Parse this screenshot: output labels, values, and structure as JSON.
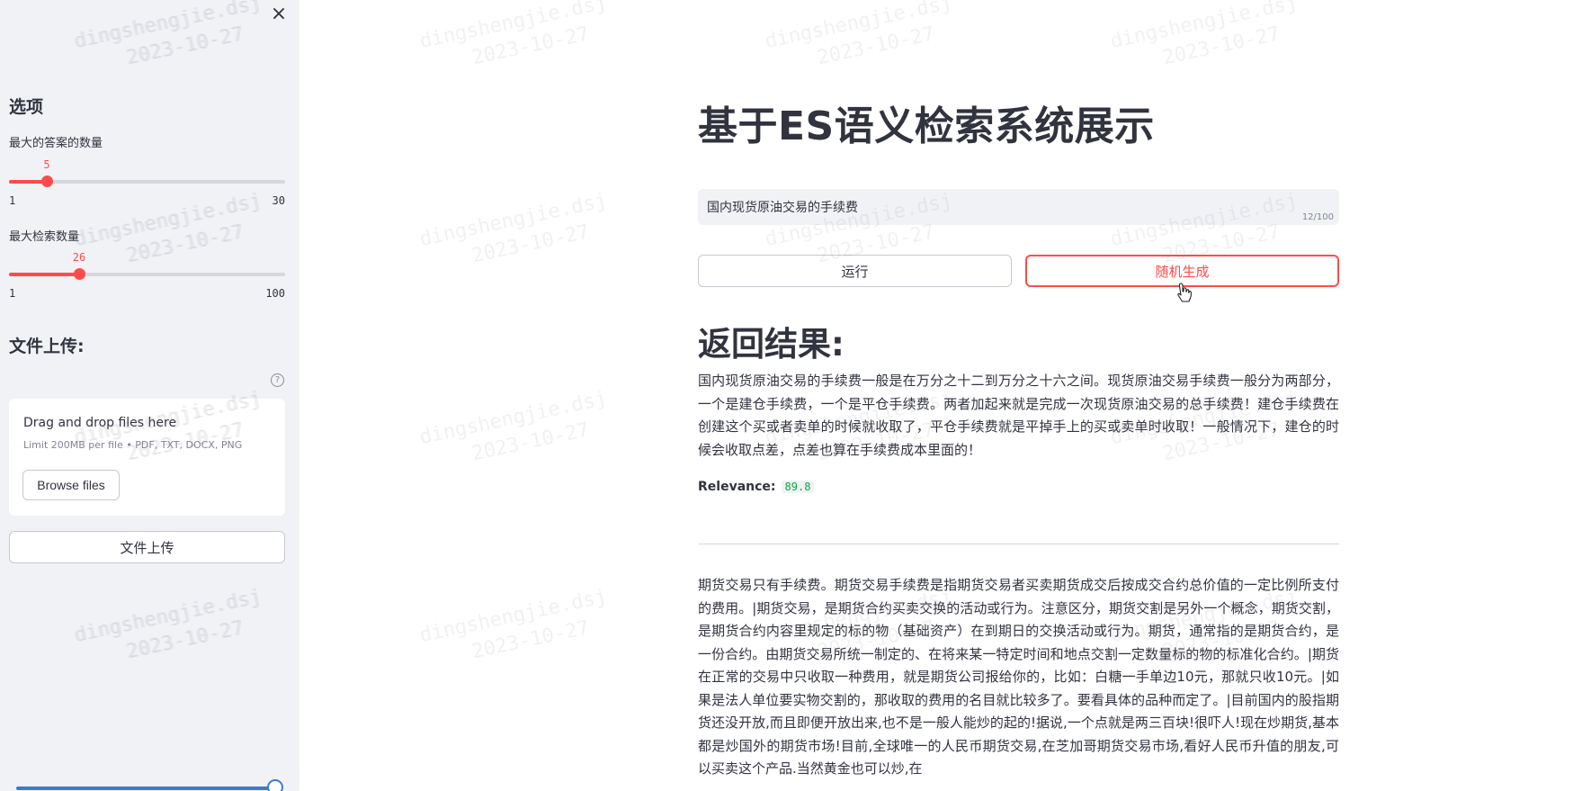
{
  "sidebar": {
    "close_glyph": "×",
    "heading": "选项",
    "slider_answers": {
      "label": "最大的答案的数量",
      "value": 5,
      "min": 1,
      "max": 30
    },
    "slider_search": {
      "label": "最大检索数量",
      "value": 26,
      "min": 1,
      "max": 100
    },
    "upload_heading": "文件上传:",
    "help_glyph": "?",
    "dropzone": {
      "title": "Drag and drop files here",
      "subtitle": "Limit 200MB per file • PDF, TXT, DOCX, PNG",
      "browse_label": "Browse files"
    },
    "upload_button": "文件上传"
  },
  "main": {
    "title": "基于ES语义检索系统展示",
    "query": {
      "value": "国内现货原油交易的手续费",
      "counter": "12/100"
    },
    "run_label": "运行",
    "random_label": "随机生成",
    "results_heading": "返回结果:",
    "results": [
      {
        "text": "国内现货原油交易的手续费一般是在万分之十二到万分之十六之间。现货原油交易手续费一般分为两部分，一个是建仓手续费，一个是平仓手续费。两者加起来就是完成一次现货原油交易的总手续费！建仓手续费在创建这个买或者卖单的时候就收取了，平仓手续费就是平掉手上的买或卖单时收取！一般情况下，建仓的时候会收取点差，点差也算在手续费成本里面的！",
        "relevance_label": "Relevance:",
        "relevance": "89.8"
      },
      {
        "text": "期货交易只有手续费。期货交易手续费是指期货交易者买卖期货成交后按成交合约总价值的一定比例所支付的费用。|期货交易，是期货合约买卖交换的活动或行为。注意区分，期货交割是另外一个概念，期货交割，是期货合约内容里规定的标的物（基础资产）在到期日的交换活动或行为。期货，通常指的是期货合约，是一份合约。由期货交易所统一制定的、在将来某一特定时间和地点交割一定数量标的物的标准化合约。|期货在正常的交易中只收取一种费用，就是期货公司报给你的，比如：白糖一手单边10元，那就只收10元。|如果是法人单位要实物交割的，那收取的费用的名目就比较多了。要看具体的品种而定了。|目前国内的股指期货还没开放,而且即便开放出来,也不是一般人能炒的起的!据说,一个点就是两三百块!很吓人!现在炒期货,基本都是炒国外的期货市场!目前,全球唯一的人民币期货交易,在芝加哥期货交易市场,看好人民币升值的朋友,可以买卖这个产品.当然黄金也可以炒,在"
      }
    ]
  },
  "watermark": {
    "line1": "dingshengjie.dsj",
    "line2": "2023-10-27"
  },
  "colors": {
    "accent": "#ff4b4b",
    "sidebar_bg": "#f0f2f6",
    "text": "#31333f",
    "relevance": "#09ab3b"
  },
  "icons": [
    "close-icon",
    "help-icon",
    "pointer-cursor-icon"
  ]
}
